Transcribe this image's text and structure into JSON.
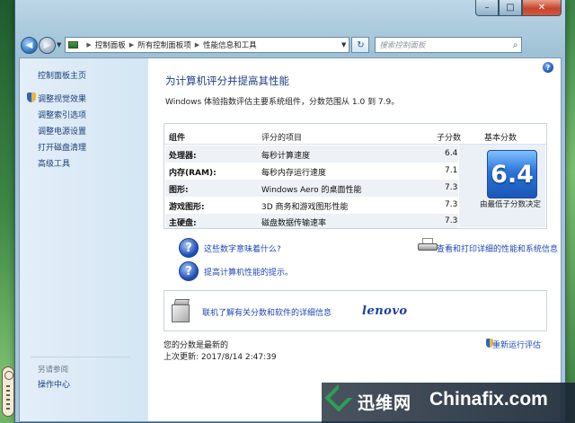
{
  "window": {
    "caption": {
      "minimize": "–",
      "maximize": "□",
      "close": "✕"
    }
  },
  "nav": {
    "breadcrumbs": [
      "控制面板",
      "所有控制面板项",
      "性能信息和工具"
    ],
    "search_placeholder": "搜索控制面板"
  },
  "sidebar": {
    "home": "控制面板主页",
    "links": [
      "调整视觉效果",
      "调整索引选项",
      "调整电源设置",
      "打开磁盘清理",
      "高级工具"
    ],
    "see_also_title": "另请参阅",
    "see_also_links": [
      "操作中心"
    ]
  },
  "main": {
    "title": "为计算机评分并提高其性能",
    "intro": "Windows 体验指数评估主要系统组件，分数范围从 1.0 到 7.9。",
    "table": {
      "headers": {
        "component": "组件",
        "rated": "评分的项目",
        "subscore": "子分数",
        "base": "基本分数"
      },
      "rows": [
        {
          "component": "处理器:",
          "desc": "每秒计算速度",
          "score": "6.4"
        },
        {
          "component": "内存(RAM):",
          "desc": "每秒内存运行速度",
          "score": "7.1"
        },
        {
          "component": "图形:",
          "desc": "Windows Aero 的桌面性能",
          "score": "7.3"
        },
        {
          "component": "游戏图形:",
          "desc": "3D 商务和游戏图形性能",
          "score": "7.3"
        },
        {
          "component": "主硬盘:",
          "desc": "磁盘数据传输速率",
          "score": "7.3"
        }
      ],
      "base_score": "6.4",
      "base_note": "由最低子分数决定"
    },
    "links": {
      "what_mean": "这些数字意味着什么?",
      "improve": "提高计算机性能的提示。",
      "view_print": "查看和打印详细的性能和系统信息"
    },
    "promo": {
      "text": "联机了解有关分数和软件的详细信息",
      "brand": "lenovo"
    },
    "status": {
      "current": "您的分数是最新的",
      "last_update": "上次更新: 2017/8/14 2:47:39",
      "rerun": "重新运行评估"
    }
  },
  "watermark": {
    "cn": "迅维网",
    "en": "Chinafix.com"
  }
}
